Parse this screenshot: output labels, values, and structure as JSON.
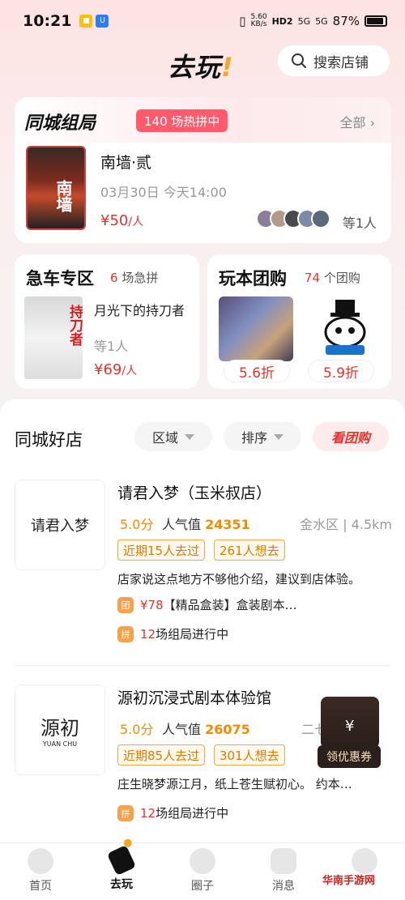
{
  "status_bar": {
    "time": "10:21",
    "network_speed": "5.60",
    "network_unit": "KB/s",
    "signal_labels": [
      "HD2",
      "5G",
      "5G"
    ],
    "battery": "87%"
  },
  "header": {
    "logo": "去玩",
    "logo_mark": "!",
    "search_placeholder": "搜索店铺"
  },
  "group_card": {
    "title": "同城组局",
    "hot_badge": "140 场热拼中",
    "all_link": "全部",
    "poster_text": "南墙",
    "event_name": "南墙·贰",
    "event_time": "03月30日 今天14:00",
    "price": "¥50",
    "price_unit": "/人",
    "participants_more": "等1人",
    "avatar_colors": [
      "#8a7f9a",
      "#b39a8a",
      "#4a4a4a",
      "#7a8aa8",
      "#5a6a7a"
    ]
  },
  "rush_card": {
    "title": "急车专区",
    "count": "6",
    "count_suffix": "场急拼",
    "poster_text": "持刀者",
    "item_name": "月光下的持刀者",
    "participants_more": "等1人",
    "price": "¥69",
    "price_unit": "/人"
  },
  "deal_card": {
    "title": "玩本团购",
    "count": "74",
    "count_suffix": "个团购",
    "discount_1": "5.6折",
    "discount_2": "5.9折"
  },
  "shops": {
    "title": "同城好店",
    "filter_area": "区域",
    "filter_sort": "排序",
    "filter_deal": "看团购",
    "items": [
      {
        "name": "请君入梦（玉米叔店）",
        "logo_text": "请君入梦",
        "rating": "5.0分",
        "popularity_label": "人气值",
        "popularity": "24351",
        "distance": "金水区 | 4.5km",
        "tag_1": "近期15人去过",
        "tag_2": "261人想去",
        "desc": "店家说这点地方不够他介绍，建议到店体验。",
        "deal_badge": "团",
        "deal_price": "¥78",
        "deal_text": "【精品盒装】盒装剧本…",
        "group_badge": "拼",
        "group_count": "12",
        "group_text": "场组局进行中"
      },
      {
        "name": "源初沉浸式剧本体验馆",
        "logo_text": "源初",
        "logo_sub": "YUAN CHU",
        "rating": "5.0分",
        "popularity_label": "人气值",
        "popularity": "26075",
        "distance": "二七",
        "tag_1": "近期85人去过",
        "tag_2": "301人想去",
        "desc": "庄生晓梦源江月，纸上苍生赋初心。 约本…",
        "group_badge": "拼",
        "group_count": "12",
        "group_text": "场组局进行中"
      }
    ]
  },
  "coupon": {
    "label": "领优惠券"
  },
  "bottom_nav": [
    {
      "label": "首页"
    },
    {
      "label": "去玩"
    },
    {
      "label": "圈子"
    },
    {
      "label": "消息"
    },
    {
      "label": ""
    }
  ],
  "watermark": "华南手游网"
}
